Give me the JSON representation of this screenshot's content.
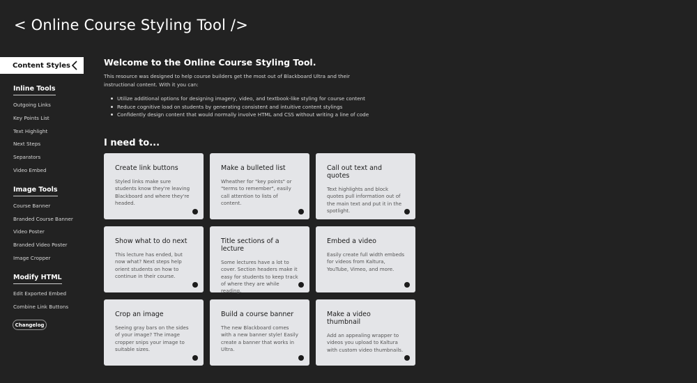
{
  "app": {
    "title": "< Online Course Styling Tool />"
  },
  "sidebar": {
    "header": "Content Styles",
    "sections": [
      {
        "title": "Inline Tools",
        "items": [
          "Outgoing Links",
          "Key Points List",
          "Text Highlight",
          "Next Steps",
          "Separators",
          "Video Embed"
        ]
      },
      {
        "title": "Image Tools",
        "items": [
          "Course Banner",
          "Branded Course Banner",
          "Video Poster",
          "Branded Video Poster",
          "Image Cropper"
        ]
      },
      {
        "title": "Modify HTML",
        "items": [
          "Edit Exported Embed",
          "Combine Link Buttons"
        ]
      }
    ],
    "changelog": "Changelog"
  },
  "main": {
    "welcome_title": "Welcome to the Online Course Styling Tool.",
    "intro": "This resource was designed to help course builders get the most out of Blackboard Ultra and their instructional content. With it you can:",
    "bullets": [
      "Utilize additional options for designing imagery, video, and textbook-like styling for course content",
      "Reduce cognitive load on students by generating consistent and intuitive content stylings",
      "Confidently design content that would normally involve HTML and CSS without writing a line of code"
    ],
    "need_title": "I need to...",
    "cards": [
      {
        "title": "Create link buttons",
        "desc": "Styled links make sure students know they're leaving Blackboard and where they're headed."
      },
      {
        "title": "Make a bulleted list",
        "desc": "Wheather for \"key points\" or \"terms to remember\", easily call attention to lists of content."
      },
      {
        "title": "Call out text and quotes",
        "desc": "Text highlights and block quotes pull information out of the main text and put it in the spotlight."
      },
      {
        "title": "Show what to do next",
        "desc": "This lecture has ended, but now what? Next steps help orient students on how to continue in their course."
      },
      {
        "title": "Title sections of a lecture",
        "desc": "Some lectures have a lot to cover. Section headers make it easy for students to keep track of where they are while reading."
      },
      {
        "title": "Embed a video",
        "desc": "Easily create full width embeds for videos from Kaltura, YouTube, Vimeo, and more."
      },
      {
        "title": "Crop an image",
        "desc": "Seeing gray bars on the sides of your image? The image cropper snips your image to suitable sizes."
      },
      {
        "title": "Build a course banner",
        "desc": "The new Blackboard comes with a new banner style! Easily create a banner that works in Ultra."
      },
      {
        "title": "Make a video thumbnail",
        "desc": "Add an appealing wrapper to videos you upload to Kaltura with custom video thumbnails."
      }
    ]
  }
}
